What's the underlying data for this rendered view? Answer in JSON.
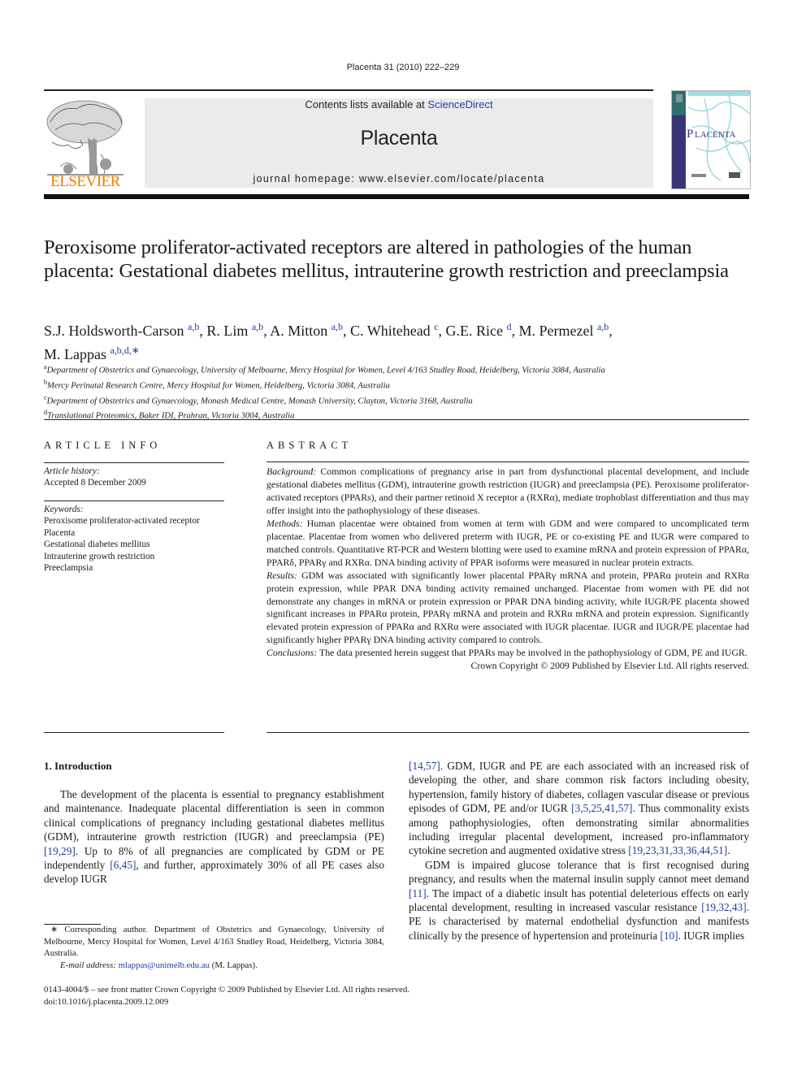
{
  "header": {
    "citation": "Placenta 31 (2010) 222–229",
    "contents_prefix": "Contents lists available at ",
    "contents_link": "ScienceDirect",
    "journal_name": "Placenta",
    "homepage": "journal homepage: www.elsevier.com/locate/placenta",
    "publisher_logo_text": "ELSEVIER",
    "cover_title": "PLACENTA",
    "colors": {
      "link": "#1f3f9c",
      "elsevier_orange": "#f07c00",
      "banner_bg": "#ebebeb",
      "cover_purple": "#3a3476",
      "cover_cyan": "#6fc6d4"
    }
  },
  "article": {
    "title": "Peroxisome proliferator-activated receptors are altered in pathologies of the human placenta: Gestational diabetes mellitus, intrauterine growth restriction and preeclampsia",
    "authors": [
      {
        "name": "S.J. Holdsworth-Carson",
        "aff": "a,b",
        "sep": ", "
      },
      {
        "name": "R. Lim",
        "aff": "a,b",
        "sep": ", "
      },
      {
        "name": "A. Mitton",
        "aff": "a,b",
        "sep": ", "
      },
      {
        "name": "C. Whitehead",
        "aff": "c",
        "sep": ", "
      },
      {
        "name": "G.E. Rice",
        "aff": "d",
        "sep": ", "
      },
      {
        "name": "M. Permezel",
        "aff": "a,b",
        "sep": ","
      },
      {
        "name": "M. Lappas",
        "aff": "a,b,d,∗",
        "sep": ""
      }
    ],
    "affiliations": [
      {
        "key": "a",
        "text": "Department of Obstetrics and Gynaecology, University of Melbourne, Mercy Hospital for Women, Level 4/163 Studley Road, Heidelberg, Victoria 3084, Australia"
      },
      {
        "key": "b",
        "text": "Mercy Perinatal Research Centre, Mercy Hospital for Women, Heidelberg, Victoria 3084, Australia"
      },
      {
        "key": "c",
        "text": "Department of Obstetrics and Gynaecology, Monash Medical Centre, Monash University, Clayton, Victoria 3168, Australia"
      },
      {
        "key": "d",
        "text": "Translational Proteomics, Baker IDI, Prahran, Victoria 3004, Australia"
      }
    ]
  },
  "article_info": {
    "heading": "ARTICLE INFO",
    "history_label": "Article history:",
    "accepted": "Accepted 8 December 2009",
    "keywords_label": "Keywords:",
    "keywords": [
      "Peroxisome proliferator-activated receptor",
      "Placenta",
      "Gestational diabetes mellitus",
      "Intrauterine growth restriction",
      "Preeclampsia"
    ]
  },
  "abstract": {
    "heading": "ABSTRACT",
    "sections": [
      {
        "label": "Background:",
        "text": " Common complications of pregnancy arise in part from dysfunctional placental development, and include gestational diabetes mellitus (GDM), intrauterine growth restriction (IUGR) and preeclampsia (PE). Peroxisome proliferator-activated receptors (PPARs), and their partner retinoid X receptor a (RXRα), mediate trophoblast differentiation and thus may offer insight into the pathophysiology of these diseases."
      },
      {
        "label": "Methods:",
        "text": " Human placentae were obtained from women at term with GDM and were compared to uncomplicated term placentae. Placentae from women who delivered preterm with IUGR, PE or co-existing PE and IUGR were compared to matched controls. Quantitative RT-PCR and Western blotting were used to examine mRNA and protein expression of PPARα, PPARδ, PPARγ and RXRα. DNA binding activity of PPAR isoforms were measured in nuclear protein extracts."
      },
      {
        "label": "Results:",
        "text": " GDM was associated with significantly lower placental PPARγ mRNA and protein, PPARα protein and RXRα protein expression, while PPAR DNA binding activity remained unchanged. Placentae from women with PE did not demonstrate any changes in mRNA or protein expression or PPAR DNA binding activity, while IUGR/PE placenta showed significant increases in PPARα protein, PPARγ mRNA and protein and RXRα mRNA and protein expression. Significantly elevated protein expression of PPARα and RXRα were associated with IUGR placentae. IUGR and IUGR/PE placentae had significantly higher PPARγ DNA binding activity compared to controls."
      },
      {
        "label": "Conclusions:",
        "text": " The data presented herein suggest that PPARs may be involved in the pathophysiology of GDM, PE and IUGR."
      }
    ],
    "copyright": "Crown Copyright © 2009 Published by Elsevier Ltd. All rights reserved."
  },
  "body": {
    "section_heading": "1.  Introduction",
    "left_para": [
      {
        "t": "The development of the placenta is essential to pregnancy establishment and maintenance. Inadequate placental differentiation is seen in common clinical complications of pregnancy including gestational diabetes mellitus (GDM), intrauterine growth restriction (IUGR) and preeclampsia (PE) "
      },
      {
        "ref": "[19,29]"
      },
      {
        "t": ". Up to 8% of all pregnancies are complicated by GDM or PE independently "
      },
      {
        "ref": "[6,45]"
      },
      {
        "t": ", and further, approximately 30% of all PE cases also develop IUGR"
      }
    ],
    "right_para1": [
      {
        "ref": "[14,57]"
      },
      {
        "t": ". GDM, IUGR and PE are each associated with an increased risk of developing the other, and share common risk factors including obesity, hypertension, family history of diabetes, collagen vascular disease or previous episodes of GDM, PE and/or IUGR "
      },
      {
        "ref": "[3,5,25,41,57]"
      },
      {
        "t": ". Thus commonality exists among pathophysiologies, often demonstrating similar abnormalities including irregular placental development, increased pro-inflammatory cytokine secretion and augmented oxidative stress "
      },
      {
        "ref": "[19,23,31,33,36,44,51]"
      },
      {
        "t": "."
      }
    ],
    "right_para2": [
      {
        "t": "GDM is impaired glucose tolerance that is first recognised during pregnancy, and results when the maternal insulin supply cannot meet demand "
      },
      {
        "ref": "[11]"
      },
      {
        "t": ". The impact of a diabetic insult has potential deleterious effects on early placental development, resulting in increased vascular resistance "
      },
      {
        "ref": "[19,32,43]"
      },
      {
        "t": ". PE is characterised by maternal endothelial dysfunction and manifests clinically by the presence of hypertension and proteinuria "
      },
      {
        "ref": "[10]"
      },
      {
        "t": ". IUGR implies"
      }
    ]
  },
  "footnote": {
    "corresponding": "∗  Corresponding author. Department of Obstetrics and Gynaecology, University of Melbourne, Mercy Hospital for Women, Level 4/163 Studley Road, Heidelberg, Victoria 3084, Australia.",
    "email_label": "E-mail address:",
    "email": "mlappas@unimelb.edu.au",
    "email_suffix": " (M. Lappas)."
  },
  "bottom": {
    "issn_line": "0143-4004/$ – see front matter Crown Copyright © 2009 Published by Elsevier Ltd. All rights reserved.",
    "doi": "doi:10.1016/j.placenta.2009.12.009"
  }
}
